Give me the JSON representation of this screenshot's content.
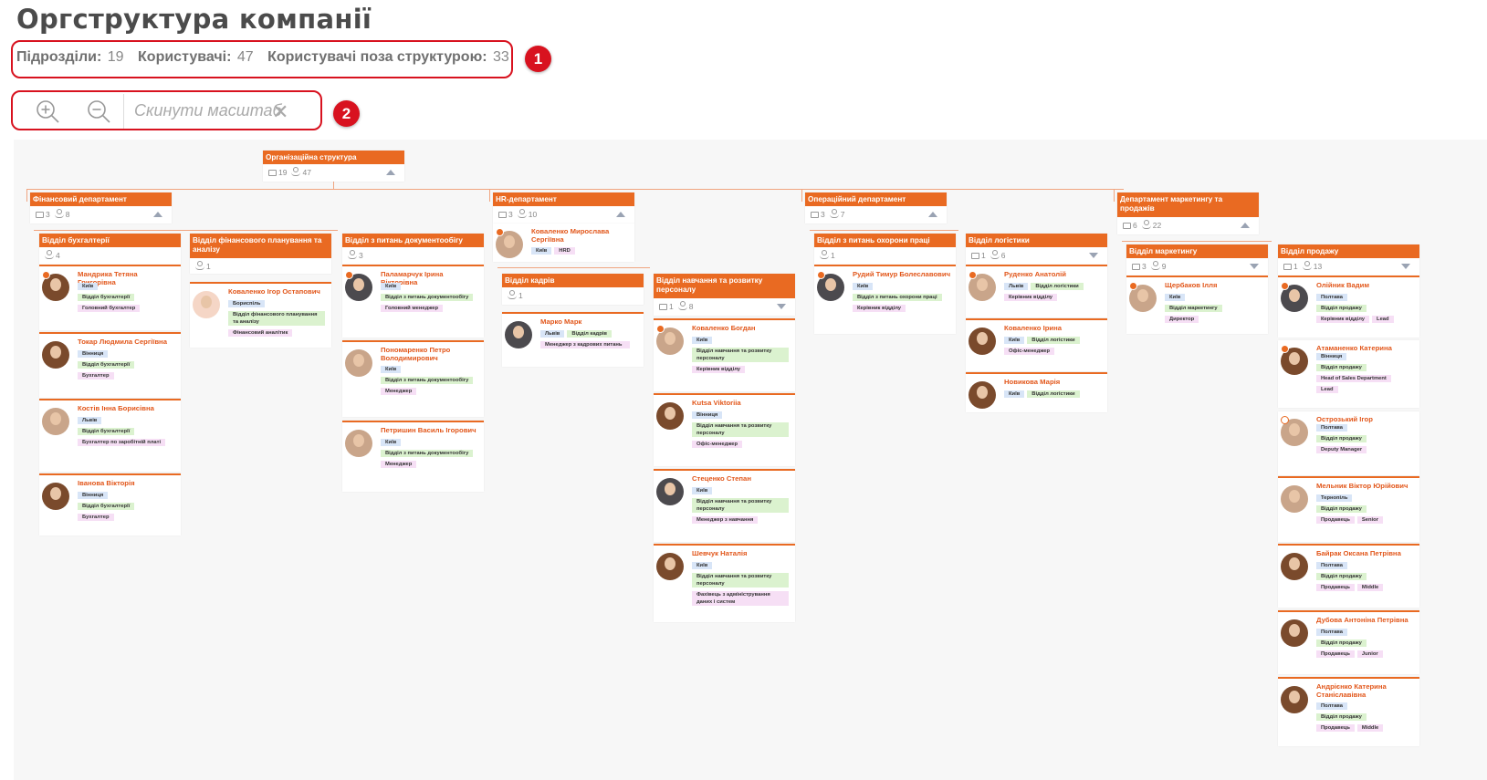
{
  "title": "Оргструктура компанії",
  "stats": {
    "dept_label": "Підрозділи:",
    "dept_value": "19",
    "users_label": "Користувачі:",
    "users_value": "47",
    "outside_label": "Користувачі поза структурою:",
    "outside_value": "33"
  },
  "badges": {
    "b1": "1",
    "b2": "2"
  },
  "zoom": {
    "reset_label": "Скинути масштаб"
  },
  "colors": {
    "accent": "#e96a22",
    "highlight": "#d8121f"
  },
  "nodes": {
    "root": {
      "name": "Організаційна структура",
      "folders": "19",
      "users": "47"
    },
    "fin": {
      "name": "Фінансовий департамент",
      "folders": "3",
      "users": "8"
    },
    "hr": {
      "name": "HR-департамент",
      "folders": "3",
      "users": "10"
    },
    "ops": {
      "name": "Операційний департамент",
      "folders": "3",
      "users": "7"
    },
    "mkt": {
      "name": "Департамент маркетингу та продажів",
      "folders": "6",
      "users": "22"
    },
    "buh": {
      "name": "Відділ бухгалтерії",
      "users": "4"
    },
    "plan": {
      "name": "Відділ фінансового планування та аналізу",
      "users": "1"
    },
    "doc": {
      "name": "Відділ з питань документообігу",
      "users": "3"
    },
    "kadr": {
      "name": "Відділ кадрів",
      "users": "1"
    },
    "nav": {
      "name": "Відділ навчання та розвитку персоналу",
      "folders": "1",
      "users": "8"
    },
    "ohor": {
      "name": "Відділ з питань охорони праці",
      "users": "1"
    },
    "log": {
      "name": "Відділ логістики",
      "folders": "1",
      "users": "6"
    },
    "vmkt": {
      "name": "Відділ маркетингу",
      "folders": "3",
      "users": "9"
    },
    "sale": {
      "name": "Відділ продажу",
      "folders": "1",
      "users": "13"
    }
  },
  "people": {
    "p1": {
      "name": "Мандрика Тетяна Григорівна",
      "tags": [
        "Київ",
        "Відділ бухгалтерії",
        "Головний бухгалтер"
      ]
    },
    "p2": {
      "name": "Токар Людмила Сергіївна",
      "tags": [
        "Вінниця",
        "Відділ бухгалтерії",
        "Бухгалтер"
      ]
    },
    "p3": {
      "name": "Костів Інна Борисівна",
      "tags": [
        "Львів",
        "Відділ бухгалтерії",
        "Бухгалтер по заробітній платі"
      ]
    },
    "p4": {
      "name": "Іванова Вікторія",
      "tags": [
        "Вінниця",
        "Відділ бухгалтерії",
        "Бухгалтер"
      ]
    },
    "p5": {
      "name": "Коваленко Ігор Остапович",
      "tags": [
        "Бориспіль",
        "Відділ фінансового планування та аналізу",
        "Фінансовий аналітик"
      ]
    },
    "p6": {
      "name": "Паламарчук Ірина Вікторівна",
      "tags": [
        "Київ",
        "Відділ з питань документообігу",
        "Головний менеджер"
      ]
    },
    "p7": {
      "name": "Пономаренко Петро Володимирович",
      "tags": [
        "Київ",
        "Відділ з питань документообігу",
        "Менеджер"
      ]
    },
    "p8": {
      "name": "Петришин Василь Ігорович",
      "tags": [
        "Київ",
        "Відділ з питань документообігу",
        "Менеджер"
      ]
    },
    "p9": {
      "name": "Коваленко Мирослава Сергіївна",
      "tags": [
        "Київ",
        "HRD"
      ]
    },
    "p10": {
      "name": "Марко Марк",
      "tags": [
        "Львів",
        "Відділ кадрів",
        "Менеджер з кадрових питань"
      ]
    },
    "p11": {
      "name": "Коваленко Богдан",
      "tags": [
        "Київ",
        "Відділ навчання та розвитку персоналу",
        "Керівник відділу"
      ]
    },
    "p12": {
      "name": "Kutsa Viktoriia",
      "tags": [
        "Вінниця",
        "Відділ навчання та розвитку персоналу",
        "Офіс-менеджер"
      ]
    },
    "p13": {
      "name": "Стеценко Степан",
      "tags": [
        "Київ",
        "Відділ навчання та розвитку персоналу",
        "Менеджер з навчання"
      ]
    },
    "p14": {
      "name": "Шевчук Наталія",
      "tags": [
        "Київ",
        "Відділ навчання та розвитку персоналу",
        "Фахівець з адміністрування даних і систем"
      ]
    },
    "p15": {
      "name": "Рудий Тимур Болеславович",
      "tags": [
        "Київ",
        "Відділ з питань охорони праці",
        "Керівник відділу"
      ]
    },
    "p16": {
      "name": "Руденко Анатолій",
      "tags": [
        "Львів",
        "Відділ логістики",
        "Керівник відділу"
      ]
    },
    "p17": {
      "name": "Коваленко Ірина",
      "tags": [
        "Київ",
        "Відділ логістики",
        "Офіс-менеджер"
      ]
    },
    "p18": {
      "name": "Новикова Марія",
      "tags": [
        "Київ",
        "Відділ логістики"
      ]
    },
    "p19": {
      "name": "Щербаков Ілля",
      "tags": [
        "Київ",
        "Відділ маркетингу",
        "Директор"
      ]
    },
    "p20": {
      "name": "Олійник Вадим",
      "tags": [
        "Полтава",
        "Відділ продажу",
        "Керівник відділу",
        "Lead"
      ]
    },
    "p21": {
      "name": "Атаманенко Катерина",
      "tags": [
        "Вінниця",
        "Відділ продажу",
        "Head of Sales Department",
        "Lead"
      ]
    },
    "p22": {
      "name": "Острозький Ігор",
      "tags": [
        "Полтава",
        "Відділ продажу",
        "Deputy Manager"
      ]
    },
    "p23": {
      "name": "Мельник Віктор Юрійович",
      "tags": [
        "Тернопіль",
        "Відділ продажу",
        "Продавець",
        "Senior"
      ]
    },
    "p24": {
      "name": "Байрак Оксана Петрівна",
      "tags": [
        "Полтава",
        "Відділ продажу",
        "Продавець",
        "Middle"
      ]
    },
    "p25": {
      "name": "Дубова Антоніна Петрівна",
      "tags": [
        "Полтава",
        "Відділ продажу",
        "Продавець",
        "Junior"
      ]
    },
    "p26": {
      "name": "Андрієнко Катерина Станіславівна",
      "tags": [
        "Полтава",
        "Відділ продажу",
        "Продавець",
        "Middle"
      ]
    }
  }
}
